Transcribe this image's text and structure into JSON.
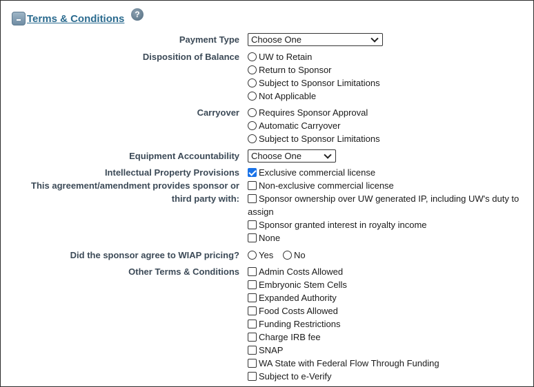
{
  "section": {
    "title": "Terms & Conditions",
    "help_icon": "question-icon",
    "collapse_symbol": "-"
  },
  "payment_type": {
    "label": "Payment Type",
    "selected": "Choose One"
  },
  "disposition": {
    "label": "Disposition of Balance",
    "options": [
      "UW to Retain",
      "Return to Sponsor",
      "Subject to Sponsor Limitations",
      "Not Applicable"
    ]
  },
  "carryover": {
    "label": "Carryover",
    "options": [
      "Requires Sponsor Approval",
      "Automatic Carryover",
      "Subject to Sponsor Limitations"
    ]
  },
  "equipment": {
    "label": "Equipment Accountability",
    "selected": "Choose One"
  },
  "ip": {
    "label_line1": "Intellectual Property Provisions",
    "label_line2": "This agreement/amendment provides sponsor or",
    "label_line3": "third party with:",
    "options": [
      {
        "text": "Exclusive commercial license",
        "checked": true
      },
      {
        "text": "Non-exclusive commercial license",
        "checked": false
      },
      {
        "text": "Sponsor ownership over UW generated IP, including UW's duty to",
        "text2": "assign",
        "checked": false
      },
      {
        "text": "Sponsor granted interest in royalty income",
        "checked": false
      },
      {
        "text": "None",
        "checked": false
      }
    ]
  },
  "wiap": {
    "label": "Did the sponsor agree to WIAP pricing?",
    "yes": "Yes",
    "no": "No"
  },
  "other": {
    "label": "Other Terms & Conditions",
    "options": [
      "Admin Costs Allowed",
      "Embryonic Stem Cells",
      "Expanded Authority",
      "Food Costs Allowed",
      "Funding Restrictions",
      "Charge IRB fee",
      "SNAP",
      "WA State with Federal Flow Through Funding",
      "Subject to e-Verify"
    ]
  }
}
